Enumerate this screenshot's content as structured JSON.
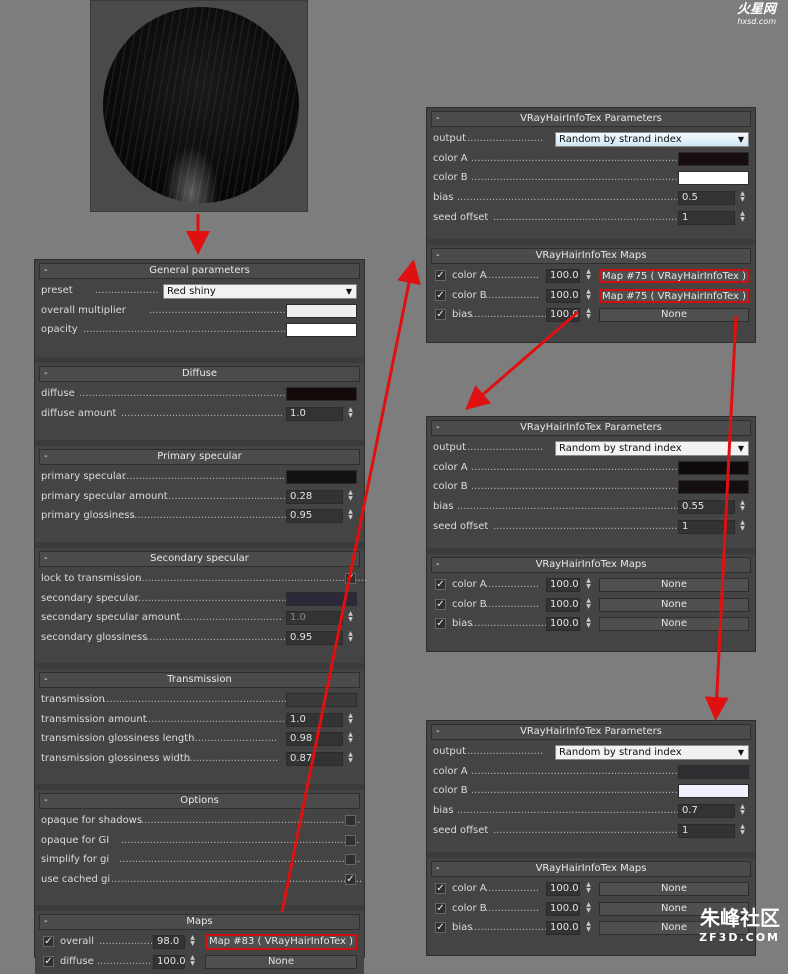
{
  "watermark_top": {
    "brand": "火星网",
    "url": "hxsd.com"
  },
  "watermark_bottom": {
    "brand": "朱峰社区",
    "url": "ZF3D.COM"
  },
  "left_panel": {
    "general": {
      "title": "General parameters",
      "preset_label": "preset",
      "preset_value": "Red shiny",
      "overall_multiplier_label": "overall multiplier",
      "opacity_label": "opacity"
    },
    "diffuse": {
      "title": "Diffuse",
      "diffuse_label": "diffuse",
      "diffuse_amount_label": "diffuse amount",
      "diffuse_amount": "1.0"
    },
    "primary": {
      "title": "Primary specular",
      "spec_label": "primary specular",
      "amount_label": "primary specular amount",
      "amount": "0.28",
      "gloss_label": "primary glossiness",
      "gloss": "0.95"
    },
    "secondary": {
      "title": "Secondary specular",
      "lock_label": "lock to transmission",
      "spec_label": "secondary specular",
      "amount_label": "secondary specular amount",
      "amount": "1.0",
      "gloss_label": "secondary glossiness",
      "gloss": "0.95"
    },
    "transmission": {
      "title": "Transmission",
      "trans_label": "transmission",
      "amount_label": "transmission amount",
      "amount": "1.0",
      "len_label": "transmission glossiness length",
      "len": "0.98",
      "width_label": "transmission glossiness width",
      "width": "0.87"
    },
    "options": {
      "title": "Options",
      "shadows_label": "opaque for shadows",
      "gi_label": "opaque for GI",
      "simplify_label": "simplify for gi",
      "cached_label": "use cached gi"
    },
    "maps": {
      "title": "Maps",
      "overall_label": "overall",
      "overall_value": "98.0",
      "overall_map": "Map #83  ( VRayHairInfoTex )",
      "diffuse_label": "diffuse",
      "diffuse_value": "100.0",
      "diffuse_map": "None"
    }
  },
  "info_panels": [
    {
      "params_title": "VRayHairInfoTex Parameters",
      "output_label": "output",
      "output_value": "Random by strand index",
      "color_a_label": "color A",
      "color_b_label": "color B",
      "bias_label": "bias",
      "bias": "0.5",
      "seed_label": "seed offset",
      "seed": "1",
      "maps_title": "VRayHairInfoTex Maps",
      "map_a_label": "color A",
      "map_a_value": "100.0",
      "map_a": "Map #75  ( VRayHairInfoTex )",
      "map_b_label": "color B",
      "map_b_value": "100.0",
      "map_b": "Map #75  ( VRayHairInfoTex )",
      "map_bias_label": "bias",
      "map_bias_value": "100.0",
      "map_bias": "None"
    },
    {
      "params_title": "VRayHairInfoTex Parameters",
      "output_label": "output",
      "output_value": "Random by strand index",
      "color_a_label": "color A",
      "color_b_label": "color B",
      "bias_label": "bias",
      "bias": "0.55",
      "seed_label": "seed offset",
      "seed": "1",
      "maps_title": "VRayHairInfoTex Maps",
      "map_a_label": "color A",
      "map_a_value": "100.0",
      "map_a": "None",
      "map_b_label": "color B",
      "map_b_value": "100.0",
      "map_b": "None",
      "map_bias_label": "bias",
      "map_bias_value": "100.0",
      "map_bias": "None"
    },
    {
      "params_title": "VRayHairInfoTex Parameters",
      "output_label": "output",
      "output_value": "Random by strand index",
      "color_a_label": "color A",
      "color_b_label": "color B",
      "bias_label": "bias",
      "bias": "0.7",
      "seed_label": "seed offset",
      "seed": "1",
      "maps_title": "VRayHairInfoTex Maps",
      "map_a_label": "color A",
      "map_a_value": "100.0",
      "map_a": "None",
      "map_b_label": "color B",
      "map_b_value": "100.0",
      "map_b": "None",
      "map_bias_label": "bias",
      "map_bias_value": "100.0",
      "map_bias": "None"
    }
  ],
  "colors": {
    "arrow": "#e01010",
    "panel_bg": "#444444",
    "background": "#7d7d7d",
    "highlight_box": "#d01010"
  }
}
